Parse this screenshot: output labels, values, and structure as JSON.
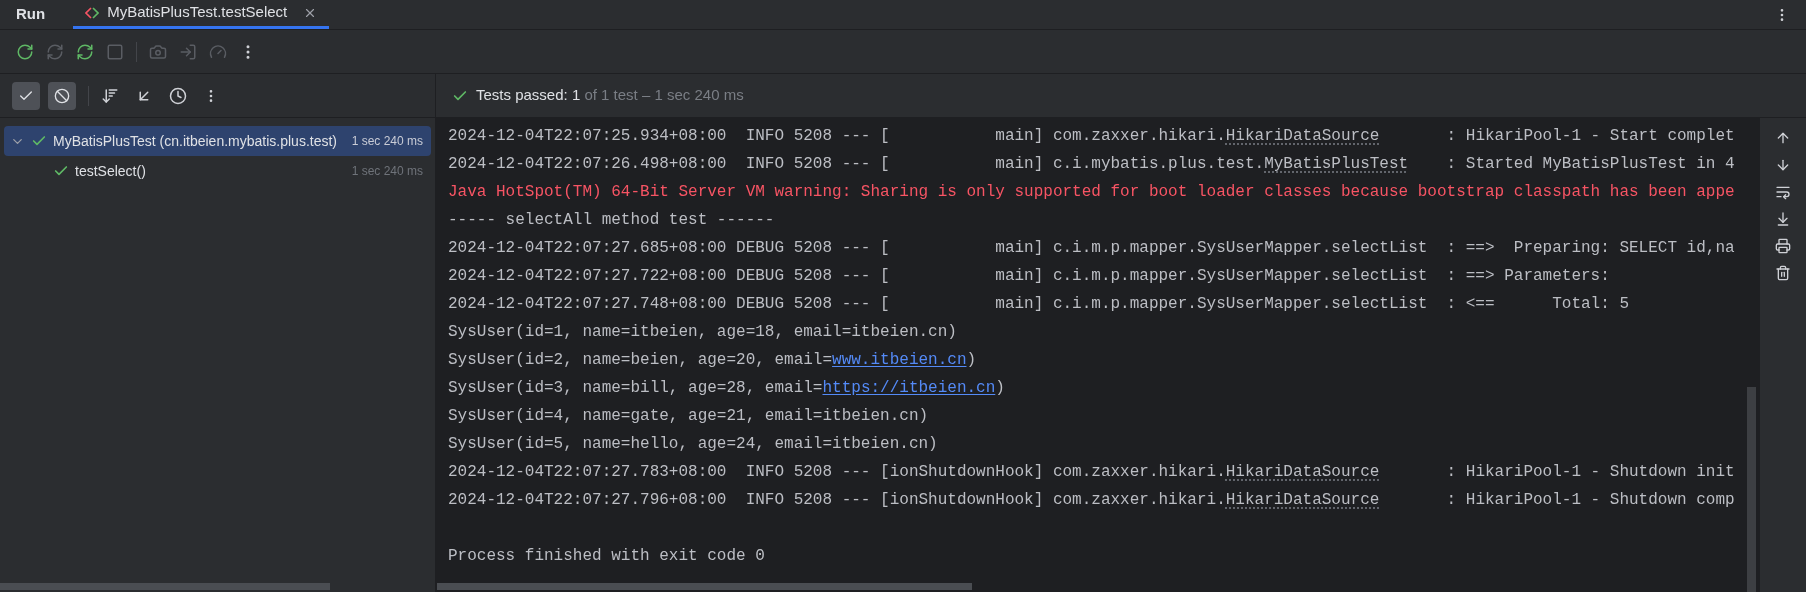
{
  "tool_window": {
    "title": "Run"
  },
  "tabs": [
    {
      "label": "MyBatisPlusTest.testSelect",
      "selected": true
    }
  ],
  "toolbar": [
    {
      "disabled": false
    },
    {
      "disabled": true
    },
    {
      "disabled": false
    },
    {
      "disabled": true
    },
    {
      "disabled": true
    },
    {
      "disabled": true
    },
    {
      "disabled": true
    },
    {
      "disabled": false
    }
  ],
  "filters": [
    {
      "selected": true
    },
    {
      "selected": true
    }
  ],
  "test_status": {
    "label": "Tests passed:",
    "count": "1",
    "detail": "of 1 test – 1 sec 240 ms"
  },
  "test_tree": [
    {
      "label": "MyBatisPlusTest (cn.itbeien.mybatis.plus.test)",
      "time": "1 sec 240 ms",
      "passed": true,
      "expanded": true,
      "selected": true,
      "children": [
        {
          "label": "testSelect()",
          "time": "1 sec 240 ms",
          "passed": true,
          "selected": false
        }
      ]
    }
  ],
  "console": [
    {
      "kind": "log",
      "parts": [
        {
          "kind": "text",
          "text": "2024-12-04T22:07:25.934+08:00  INFO 5208 --- [           main] com.zaxxer.hikari."
        },
        {
          "kind": "class_link",
          "text": "HikariDataSource"
        },
        {
          "kind": "text",
          "text": "       : HikariPool-1 - Start complet"
        }
      ]
    },
    {
      "kind": "log",
      "parts": [
        {
          "kind": "text",
          "text": "2024-12-04T22:07:26.498+08:00  INFO 5208 --- [           main] c.i.mybatis.plus.test."
        },
        {
          "kind": "class_link",
          "text": "MyBatisPlusTest"
        },
        {
          "kind": "text",
          "text": "    : Started MyBatisPlusTest in 4"
        }
      ]
    },
    {
      "kind": "error",
      "parts": [
        {
          "kind": "text",
          "text": "Java HotSpot(TM) 64-Bit Server VM warning: Sharing is only supported for boot loader classes because bootstrap classpath has been appe"
        }
      ]
    },
    {
      "kind": "log",
      "parts": [
        {
          "kind": "text",
          "text": "----- selectAll method test ------"
        }
      ]
    },
    {
      "kind": "log",
      "parts": [
        {
          "kind": "text",
          "text": "2024-12-04T22:07:27.685+08:00 DEBUG 5208 --- [           main] c.i.m.p.mapper.SysUserMapper.selectList  : ==>  Preparing: SELECT id,na"
        }
      ]
    },
    {
      "kind": "log",
      "parts": [
        {
          "kind": "text",
          "text": "2024-12-04T22:07:27.722+08:00 DEBUG 5208 --- [           main] c.i.m.p.mapper.SysUserMapper.selectList  : ==> Parameters:"
        }
      ]
    },
    {
      "kind": "log",
      "parts": [
        {
          "kind": "text",
          "text": "2024-12-04T22:07:27.748+08:00 DEBUG 5208 --- [           main] c.i.m.p.mapper.SysUserMapper.selectList  : <==      Total: 5"
        }
      ]
    },
    {
      "kind": "log",
      "parts": [
        {
          "kind": "text",
          "text": "SysUser(id=1, name=itbeien, age=18, email=itbeien.cn)"
        }
      ]
    },
    {
      "kind": "log",
      "parts": [
        {
          "kind": "text",
          "text": "SysUser(id=2, name=beien, age=20, email="
        },
        {
          "kind": "url",
          "text": "www.itbeien.cn"
        },
        {
          "kind": "text",
          "text": ")"
        }
      ]
    },
    {
      "kind": "log",
      "parts": [
        {
          "kind": "text",
          "text": "SysUser(id=3, name=bill, age=28, email="
        },
        {
          "kind": "url",
          "text": "https://itbeien.cn"
        },
        {
          "kind": "text",
          "text": ")"
        }
      ]
    },
    {
      "kind": "log",
      "parts": [
        {
          "kind": "text",
          "text": "SysUser(id=4, name=gate, age=21, email=itbeien.cn)"
        }
      ]
    },
    {
      "kind": "log",
      "parts": [
        {
          "kind": "text",
          "text": "SysUser(id=5, name=hello, age=24, email=itbeien.cn)"
        }
      ]
    },
    {
      "kind": "log",
      "parts": [
        {
          "kind": "text",
          "text": "2024-12-04T22:07:27.783+08:00  INFO 5208 --- [ionShutdownHook] com.zaxxer.hikari."
        },
        {
          "kind": "class_link",
          "text": "HikariDataSource"
        },
        {
          "kind": "text",
          "text": "       : HikariPool-1 - Shutdown init"
        }
      ]
    },
    {
      "kind": "log",
      "parts": [
        {
          "kind": "text",
          "text": "2024-12-04T22:07:27.796+08:00  INFO 5208 --- [ionShutdownHook] com.zaxxer.hikari."
        },
        {
          "kind": "class_link",
          "text": "HikariDataSource"
        },
        {
          "kind": "text",
          "text": "       : HikariPool-1 - Shutdown comp"
        }
      ]
    },
    {
      "kind": "exit",
      "parts": [
        {
          "kind": "text",
          "text": "Process finished with exit code 0"
        }
      ]
    }
  ]
}
